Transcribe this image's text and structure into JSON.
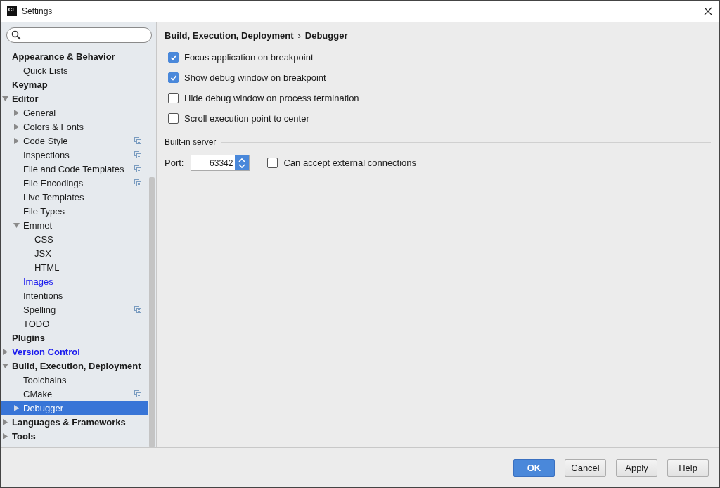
{
  "window": {
    "title": "Settings",
    "app_icon": "CL"
  },
  "sidebar": {
    "items": [
      {
        "label": "Appearance & Behavior",
        "children": [
          {
            "label": "Quick Lists"
          }
        ]
      },
      {
        "label": "Keymap"
      },
      {
        "label": "Editor",
        "expanded": true,
        "children": [
          {
            "label": "General",
            "expanded": false
          },
          {
            "label": "Colors & Fonts",
            "expanded": false
          },
          {
            "label": "Code Style",
            "expanded": false,
            "project_level": true
          },
          {
            "label": "Inspections",
            "project_level": true
          },
          {
            "label": "File and Code Templates",
            "project_level": true
          },
          {
            "label": "File Encodings",
            "project_level": true
          },
          {
            "label": "Live Templates"
          },
          {
            "label": "File Types"
          },
          {
            "label": "Emmet",
            "expanded": true,
            "children": [
              {
                "label": "CSS"
              },
              {
                "label": "JSX"
              },
              {
                "label": "HTML"
              }
            ]
          },
          {
            "label": "Images",
            "modified": true
          },
          {
            "label": "Intentions"
          },
          {
            "label": "Spelling",
            "project_level": true
          },
          {
            "label": "TODO"
          }
        ]
      },
      {
        "label": "Plugins"
      },
      {
        "label": "Version Control",
        "expanded": false,
        "modified": true
      },
      {
        "label": "Build, Execution, Deployment",
        "expanded": true,
        "children": [
          {
            "label": "Toolchains"
          },
          {
            "label": "CMake",
            "project_level": true
          },
          {
            "label": "Debugger",
            "expanded": false,
            "selected": true
          }
        ]
      },
      {
        "label": "Languages & Frameworks",
        "expanded": false
      },
      {
        "label": "Tools",
        "expanded": false
      }
    ]
  },
  "breadcrumb": {
    "parent": "Build, Execution, Deployment",
    "separator": "›",
    "current": "Debugger"
  },
  "options": [
    {
      "label": "Focus application on breakpoint",
      "checked": true
    },
    {
      "label": "Show debug window on breakpoint",
      "checked": true
    },
    {
      "label": "Hide debug window on process termination",
      "checked": false
    },
    {
      "label": "Scroll execution point to center",
      "checked": false
    }
  ],
  "built_in_server": {
    "title": "Built-in server",
    "port_label": "Port:",
    "port": "63342",
    "external": {
      "label": "Can accept external connections",
      "checked": false
    }
  },
  "buttons": [
    {
      "label": "OK",
      "default": true
    },
    {
      "label": "Cancel",
      "default": false
    },
    {
      "label": "Apply",
      "default": false
    },
    {
      "label": "Help",
      "default": false
    }
  ]
}
